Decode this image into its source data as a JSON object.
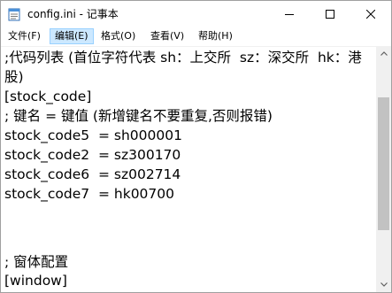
{
  "window": {
    "title": "config.ini - 记事本"
  },
  "menu": {
    "items": [
      {
        "label": "文件(F)"
      },
      {
        "label": "编辑(E)"
      },
      {
        "label": "格式(O)"
      },
      {
        "label": "查看(V)"
      },
      {
        "label": "帮助(H)"
      }
    ]
  },
  "editor": {
    "lines": [
      ";代码列表 (首位字符代表 sh：上交所  sz：深交所  hk：港",
      "股)",
      "[stock_code]",
      "; 键名 = 键值 (新增键名不要重复,否则报错)",
      "stock_code5  = sh000001",
      "stock_code2  = sz300170",
      "stock_code6  = sz002714",
      "stock_code7  = hk00700",
      "",
      "",
      "",
      "; 窗体配置",
      "[window]"
    ]
  },
  "icons": {
    "app": "notepad-icon",
    "minimize": "minimize-icon",
    "maximize": "maximize-icon",
    "close": "close-icon",
    "scroll_up": "arrow-up-icon",
    "scroll_down": "arrow-down-icon"
  },
  "colors": {
    "menu_active_bg": "#cce8ff",
    "menu_active_border": "#99d1ff",
    "scrollbar_track": "#f0f0f0",
    "scrollbar_thumb": "#c2c2c2"
  }
}
